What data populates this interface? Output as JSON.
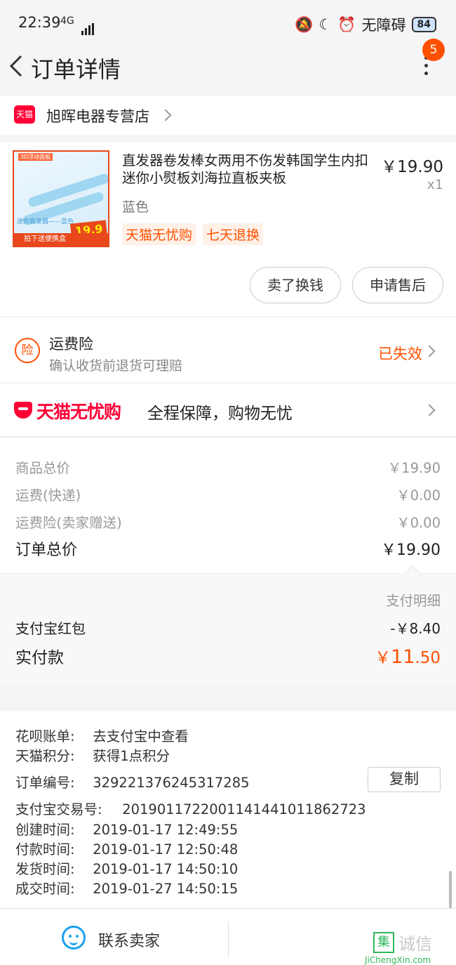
{
  "status_bar": {
    "time": "22:39",
    "signal_label": "4G",
    "accessibility_label": "无障碍",
    "battery": "84"
  },
  "header": {
    "title": "订单详情",
    "badge_count": "5"
  },
  "shop": {
    "logo_text": "天猫",
    "name": "旭晖电器专营店"
  },
  "product": {
    "name": "直发器卷发棒女两用不伤发韩国学生内扣迷你小熨板刘海拉直板夹板",
    "price": "￥19.90",
    "quantity": "x1",
    "variant": "蓝色",
    "tags": [
      "天猫无忧购",
      "七天退换"
    ],
    "thumb": {
      "corner_tag": "3D浮动面板",
      "caption": "迷你直发器——蓝色",
      "promo_price": "19.9",
      "strip_text": "拍下送便携盒"
    },
    "buttons": {
      "sell": "卖了换钱",
      "after_sale": "申请售后"
    }
  },
  "insurance": {
    "icon_text": "险",
    "title": "运费险",
    "subtitle": "确认收货前退货可理赔",
    "status": "已失效"
  },
  "guarantee": {
    "brand": "天猫无忧购",
    "text": "全程保障，购物无忧"
  },
  "price_summary": {
    "rows": [
      {
        "label": "商品总价",
        "value": "￥19.90"
      },
      {
        "label": "运费(快递)",
        "value": "￥0.00"
      },
      {
        "label": "运费险(卖家赠送)",
        "value": "￥0.00"
      }
    ],
    "total_label": "订单总价",
    "total_value": "￥19.90"
  },
  "payment": {
    "detail_link": "支付明细",
    "red_packet_label": "支付宝红包",
    "red_packet_value": "-￥8.40",
    "actual_label": "实付款",
    "actual_currency": "￥",
    "actual_int": "11",
    "actual_dec": ".50"
  },
  "order_info": {
    "huabei_label": "花呗账单:",
    "huabei_value": "去支付宝中查看",
    "points_label": "天猫积分:",
    "points_value": "获得1点积分",
    "order_no_label": "订单编号:",
    "order_no_value": "329221376245317285",
    "copy_button": "复制",
    "alipay_no_label": "支付宝交易号:",
    "alipay_no_value": "2019011722001141441011862723",
    "created_label": "创建时间:",
    "created_value": "2019-01-17 12:49:55",
    "paid_label": "付款时间:",
    "paid_value": "2019-01-17 12:50:48",
    "shipped_label": "发货时间:",
    "shipped_value": "2019-01-17 14:50:10",
    "closed_label": "成交时间:",
    "closed_value": "2019-01-27 14:50:15"
  },
  "bottom_bar": {
    "contact_seller": "联系卖家"
  },
  "watermark": {
    "box_char": "集",
    "text": "诚信",
    "url": "JiChengXin.com"
  },
  "colors": {
    "accent": "#ff5000",
    "tmall_red": "#ff0036",
    "contact_blue": "#1ba0ee"
  }
}
